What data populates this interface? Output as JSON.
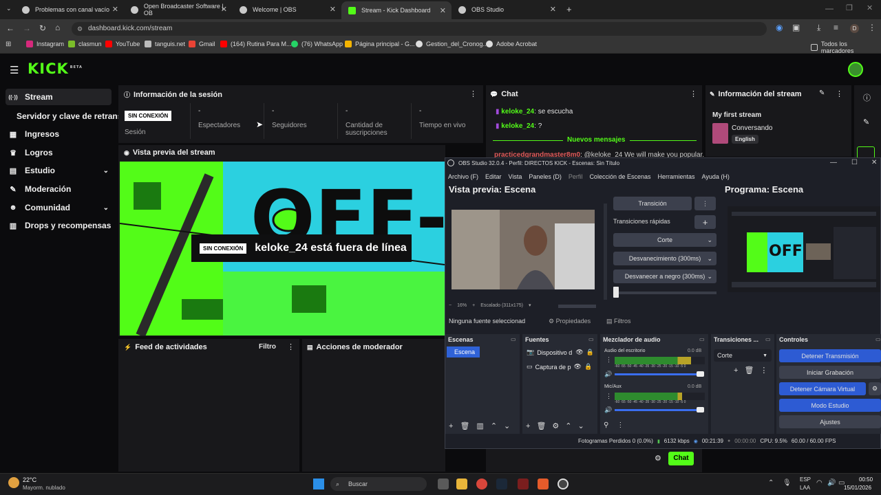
{
  "browser": {
    "tabs": [
      {
        "title": "Problemas con canal vacío",
        "fav": "#c9c9c9"
      },
      {
        "title": "Open Broadcaster Software | OB",
        "fav": "#c9c9c9"
      },
      {
        "title": "Welcome | OBS",
        "fav": "#c9c9c9"
      },
      {
        "title": "Stream - Kick Dashboard",
        "fav": "#53fc18"
      },
      {
        "title": "OBS Studio",
        "fav": "#c9c9c9"
      }
    ],
    "url": "dashboard.kick.com/stream",
    "profile_letter": "D",
    "bookmarks": [
      {
        "label": "Instagram",
        "color": "#d6297c"
      },
      {
        "label": "clasmun",
        "color": "#7bbd2a"
      },
      {
        "label": "YouTube",
        "color": "#ff0000"
      },
      {
        "label": "tanguis.net",
        "color": "#bbbbbb"
      },
      {
        "label": "Gmail",
        "color": "#ea4335"
      },
      {
        "label": "(164) Rutina Para M...",
        "color": "#ff0000"
      },
      {
        "label": "(76) WhatsApp",
        "color": "#25d366"
      },
      {
        "label": "Página principal - G...",
        "color": "#f4b400"
      },
      {
        "label": "Gestion_del_Cronog...",
        "color": "#dddddd"
      },
      {
        "label": "Adobe Acrobat",
        "color": "#dddddd"
      }
    ],
    "all_bookmarks": "Todos los marcadores"
  },
  "kick": {
    "logo": "KICK",
    "logo_beta": "BETA",
    "sidebar": [
      {
        "label": "Stream",
        "icon": "stream-icon",
        "glyph": "((·))"
      },
      {
        "label": "Servidor y clave de retransmisión",
        "icon": "",
        "glyph": ""
      },
      {
        "label": "Ingresos",
        "icon": "money-icon",
        "glyph": "▦"
      },
      {
        "label": "Logros",
        "icon": "trophy-icon",
        "glyph": "♛"
      },
      {
        "label": "Estudio",
        "icon": "studio-icon",
        "glyph": "▤"
      },
      {
        "label": "Moderación",
        "icon": "wrench-icon",
        "glyph": "✎"
      },
      {
        "label": "Comunidad",
        "icon": "community-icon",
        "glyph": "☻"
      },
      {
        "label": "Drops y recompensas",
        "icon": "drops-icon",
        "glyph": "▥"
      }
    ],
    "session": {
      "title": "Información de la sesión",
      "status_badge": "SIN CONEXIÓN",
      "stats": [
        {
          "value": "",
          "label": "Sesión"
        },
        {
          "value": "-",
          "label": "Espectadores"
        },
        {
          "value": "-",
          "label": "Seguidores"
        },
        {
          "value": "-",
          "label": "Cantidad de suscripciones"
        },
        {
          "value": "-",
          "label": "Tiempo en vivo"
        }
      ]
    },
    "preview": {
      "title": "Vista previa del stream",
      "badge": "SIN CONEXIÓN",
      "offline_text": "keloke_24 está fuera de línea",
      "bg_text": "OFF-LINE"
    },
    "activity": {
      "title": "Feed de actividades",
      "filter": "Filtro"
    },
    "modactions": {
      "title": "Acciones de moderador"
    },
    "chat": {
      "title": "Chat",
      "messages": [
        {
          "user": "keloke_24",
          "text": "se escucha"
        },
        {
          "user": "keloke_24",
          "text": "?"
        }
      ],
      "new_messages": "Nuevos mensajes",
      "spam_user": "practicedgrandmaster8m0",
      "spam_text": "@keloke_24 We will make you popular.",
      "chat_button": "Chat"
    },
    "streaminfo": {
      "title": "Información del stream",
      "stream_title": "My first stream",
      "category": "Conversando",
      "language": "English"
    }
  },
  "obs": {
    "window_title": "OBS Studio 32.0.4 - Perfil: DIRECTOS KICK - Escenas: Sin Título",
    "menu": [
      "Archivo (F)",
      "Editar",
      "Vista",
      "Paneles (D)",
      "Perfil",
      "Colección de Escenas",
      "Herramientas",
      "Ayuda (H)"
    ],
    "preview_label": "Vista previa: Escena",
    "program_label": "Programa: Escena",
    "transition_button": "Transición",
    "quick_transitions": "Transiciones rápidas",
    "quick_list": [
      "Corte",
      "Desvanecimiento (300ms)",
      "Desvanecer a negro (300ms)"
    ],
    "zoom": "16%",
    "scaled": "Escalado (311x175)",
    "no_source": "Ninguna fuente seleccionad",
    "properties": "Propiedades",
    "filters": "Filtros",
    "docks": {
      "scenes": "Escenas",
      "sources": "Fuentes",
      "mixer": "Mezclador de audio",
      "transitions": "Transiciones ...",
      "controls": "Controles"
    },
    "scene_items": [
      "Escena"
    ],
    "source_items": [
      "Dispositivo d",
      "Captura de p"
    ],
    "mixer_channels": [
      {
        "name": "Audio del escritorio",
        "db": "0.0 dB",
        "level": 0.85
      },
      {
        "name": "Mic/Aux",
        "db": "0.0 dB",
        "level": 0.75
      }
    ],
    "meter_scale": "-60 -55 -50 -45 -40 -35 -30 -25 -20 -15 -10 -5 0",
    "transition_select": "Corte",
    "controls": [
      {
        "label": "Detener Transmisión",
        "active": true
      },
      {
        "label": "Iniciar Grabación",
        "active": false
      },
      {
        "label": "Detener Cámara Virtual",
        "active": true
      },
      {
        "label": "Modo Estudio",
        "active": true
      },
      {
        "label": "Ajustes",
        "active": false
      }
    ],
    "status": {
      "dropped": "Fotogramas Perdidos 0 (0.0%)",
      "bitrate": "6132 kbps",
      "stream_time": "00:21:39",
      "rec_time": "00:00:00",
      "cpu": "CPU: 9.5%",
      "fps": "60.00 / 60.00 FPS"
    }
  },
  "taskbar": {
    "weather_temp": "22°C",
    "weather_desc": "Mayorm. nublado",
    "search": "Buscar",
    "lang": "ESP",
    "lang2": "LAA",
    "time": "00:50",
    "date": "15/01/2026"
  }
}
